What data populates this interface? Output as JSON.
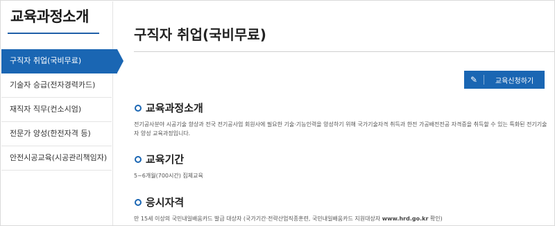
{
  "sidebar": {
    "title": "교육과정소개",
    "items": [
      {
        "label": "구직자 취업(국비무료)",
        "active": true
      },
      {
        "label": "기술자 승급(전자경력카드)",
        "active": false
      },
      {
        "label": "재직자 직무(컨소시엄)",
        "active": false
      },
      {
        "label": "전문가 양성(한전자격 등)",
        "active": false
      },
      {
        "label": "안전시공교육(시공관리책임자)",
        "active": false
      }
    ]
  },
  "main": {
    "title": "구직자 취업(국비무료)",
    "apply_button": {
      "icon": "pencil-icon",
      "label": "교육신청하기"
    },
    "sections": [
      {
        "heading": "교육과정소개",
        "body": "전기공사분야 시공기술 향상과 전국 전기공사업 회원사에 필요한 기술·기능인력을 양성하기 위해 국가기술자격 취득과 한전 가공배전전공 자격증을 취득할 수 있는 특화된 전기기술자 양성 교육과정입니다."
      },
      {
        "heading": "교육기간",
        "body": "5~6개월(700시간) 집체교육"
      },
      {
        "heading": "응시자격",
        "body": "만 15세 이상의 국민내일배움카드 발급 대상자 (국가기간·전략산업직종훈련, 국민내일배움카드 지원대상자 ",
        "url": "www.hrd.go.kr",
        "body_end": " 확인)"
      }
    ]
  },
  "colors": {
    "accent": "#1a66b3",
    "title_bar": "#1f5fa8"
  }
}
